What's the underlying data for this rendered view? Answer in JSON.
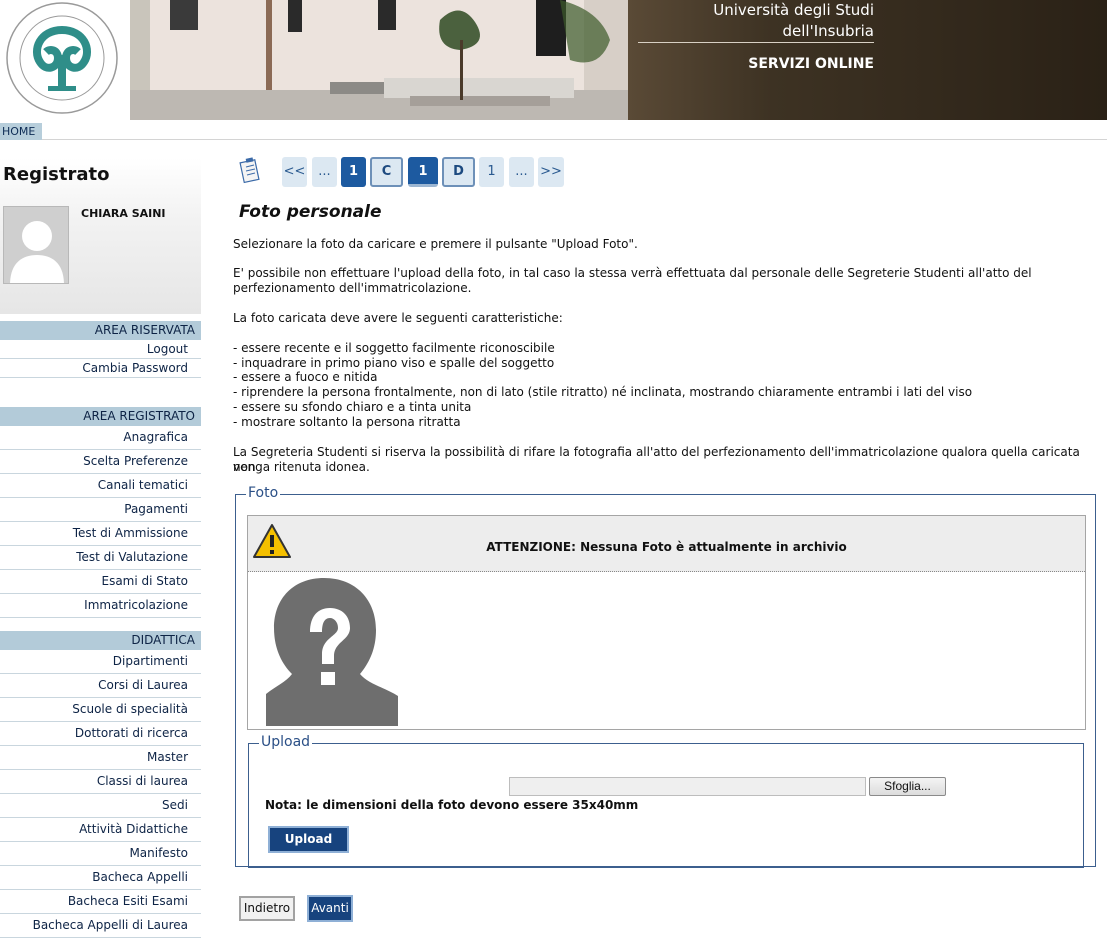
{
  "header": {
    "university_line1": "Università degli Studi",
    "university_line2": "dell'Insubria",
    "services": "SERVIZI ONLINE",
    "logo_text": "UNIVERSITAS STUDIORUM INSUBRIAE"
  },
  "nav": {
    "home": "HOME"
  },
  "sidebar": {
    "title": "Registrato",
    "user_name": "CHIARA SAINI",
    "sections": [
      {
        "heading": "AREA RISERVATA",
        "items": [
          "Logout",
          "Cambia Password"
        ]
      },
      {
        "heading": "AREA REGISTRATO",
        "items": [
          "Anagrafica",
          "Scelta Preferenze",
          "Canali tematici",
          "Pagamenti",
          "Test di Ammissione",
          "Test di Valutazione",
          "Esami di Stato",
          "Immatricolazione"
        ]
      },
      {
        "heading": "DIDATTICA",
        "items": [
          "Dipartimenti",
          "Corsi di Laurea",
          "Scuole di specialità",
          "Dottorati di ricerca",
          "Master",
          "Classi di laurea",
          "Sedi",
          "Attività Didattiche",
          "Manifesto",
          "Bacheca Appelli",
          "Bacheca Esiti Esami",
          "Bacheca Appelli di Laurea"
        ]
      }
    ]
  },
  "pager": {
    "first": "<<",
    "ellipsis_left": "...",
    "page_a": "1",
    "step_c": "C",
    "current": "1",
    "step_d": "D",
    "page_b": "1",
    "ellipsis_right": "...",
    "last": ">>"
  },
  "main": {
    "title": "Foto personale",
    "intro": "Selezionare la foto da caricare e premere il pulsante \"Upload Foto\".",
    "optional_line1": "E' possibile non effettuare l'upload della foto, in tal caso la stessa verrà effettuata dal personale delle Segreterie Studenti all'atto del",
    "optional_line2": "perfezionamento dell'immatricolazione.",
    "requirements_title": "La foto caricata deve avere le seguenti caratteristiche:",
    "requirements": [
      "- essere recente e il soggetto facilmente riconoscibile",
      "- inquadrare in primo piano viso e spalle del soggetto",
      "- essere a fuoco e nitida",
      "- riprendere la persona frontalmente, non di lato (stile ritratto) né inclinata, mostrando chiaramente entrambi i lati del viso",
      "- essere su sfondo chiaro e a tinta unita",
      "- mostrare soltanto la persona ritratta"
    ],
    "disclaimer_line1": "La Segreteria Studenti si riserva la possibilità di rifare la fotografia all'atto del perfezionamento dell'immatricolazione qualora quella caricata non",
    "disclaimer_line2": "venga ritenuta idonea."
  },
  "foto": {
    "legend": "Foto",
    "warning": "ATTENZIONE: Nessuna Foto è attualmente in archivio"
  },
  "upload": {
    "legend": "Upload",
    "file_value": "",
    "browse_label": "Sfoglia...",
    "note": "Nota: le dimensioni della foto devono essere 35x40mm",
    "button_label": "Upload Foto"
  },
  "actions": {
    "back": "Indietro",
    "next": "Avanti"
  },
  "colors": {
    "accent": "#17437e",
    "sidebar_head": "#b3cbd9",
    "legend": "#2a4f86"
  }
}
